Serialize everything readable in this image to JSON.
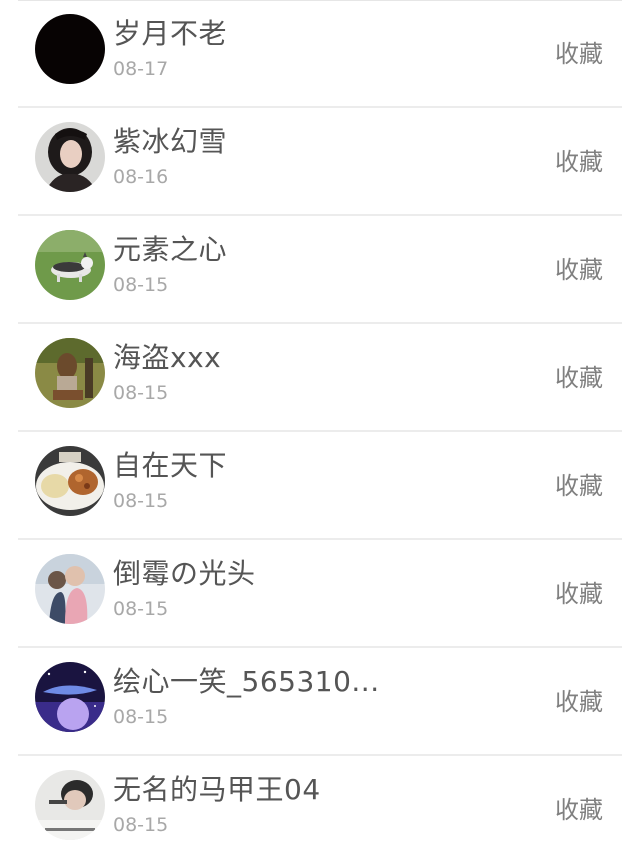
{
  "list": {
    "items": [
      {
        "name": "岁月不老",
        "date": "08-17",
        "action": "收藏"
      },
      {
        "name": "紫冰幻雪",
        "date": "08-16",
        "action": "收藏"
      },
      {
        "name": "元素之心",
        "date": "08-15",
        "action": "收藏"
      },
      {
        "name": "海盗xxx",
        "date": "08-15",
        "action": "收藏"
      },
      {
        "name": "自在天下",
        "date": "08-15",
        "action": "收藏"
      },
      {
        "name": "倒霉の光头",
        "date": "08-15",
        "action": "收藏"
      },
      {
        "name": "绘心一笑_565310...",
        "date": "08-15",
        "action": "收藏"
      },
      {
        "name": "无名的马甲王04",
        "date": "08-15",
        "action": "收藏"
      }
    ]
  },
  "colors": {
    "name_text": "#555555",
    "date_text": "#a8a8a8",
    "action_text": "#808080",
    "divider": "#ececec"
  }
}
